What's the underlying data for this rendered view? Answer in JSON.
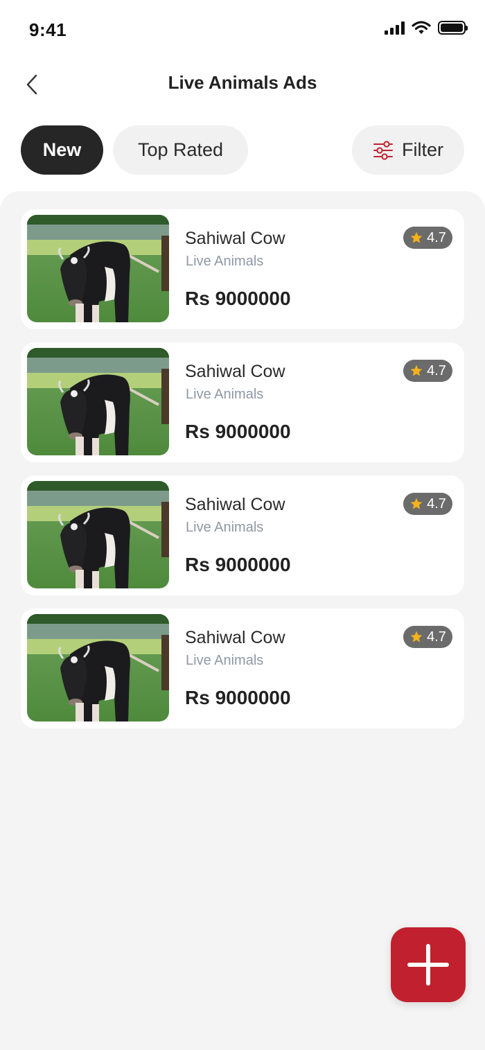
{
  "status_bar": {
    "time": "9:41"
  },
  "header": {
    "title": "Live Animals Ads"
  },
  "tabs": [
    {
      "label": "New",
      "active": true
    },
    {
      "label": "Top Rated",
      "active": false
    }
  ],
  "filter": {
    "label": "Filter",
    "icon": "sliders-icon"
  },
  "listings": [
    {
      "title": "Sahiwal Cow",
      "category": "Live Animals",
      "price": "Rs 9000000",
      "rating": "4.7"
    },
    {
      "title": "Sahiwal Cow",
      "category": "Live Animals",
      "price": "Rs 9000000",
      "rating": "4.7"
    },
    {
      "title": "Sahiwal Cow",
      "category": "Live Animals",
      "price": "Rs 9000000",
      "rating": "4.7"
    },
    {
      "title": "Sahiwal Cow",
      "category": "Live Animals",
      "price": "Rs 9000000",
      "rating": "4.7"
    }
  ],
  "fab": {
    "icon": "plus-icon"
  },
  "colors": {
    "accent": "#c1212e",
    "active_tab": "#262626",
    "rating_badge": "#6b6b6b",
    "star": "#f5b21b",
    "muted_text": "#8e98a4"
  }
}
